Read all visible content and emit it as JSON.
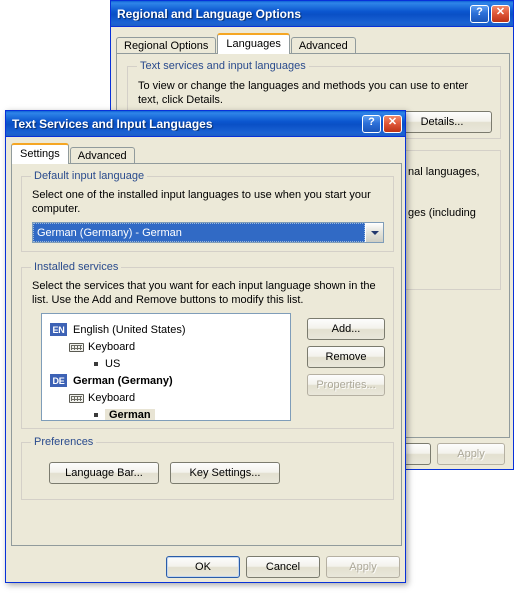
{
  "background_dialog": {
    "title": "Regional and Language Options",
    "titlebar_buttons": [
      {
        "name": "help-button",
        "glyph": "?"
      },
      {
        "name": "close-button",
        "glyph": "✕"
      }
    ],
    "tabs": [
      {
        "label": "Regional Options",
        "active": false
      },
      {
        "label": "Languages",
        "active": true
      },
      {
        "label": "Advanced",
        "active": false
      }
    ],
    "group_text_services": {
      "legend": "Text services and input languages",
      "description_line1": "To view or change the languages and methods you can use to enter",
      "description_line2": "text, click Details.",
      "details_button": "Details..."
    },
    "group_supplemental": {
      "clipped_line1": "nal languages,",
      "clipped_line2": "ges (including"
    },
    "apply_button": "Apply"
  },
  "foreground_dialog": {
    "title": "Text Services and Input Languages",
    "titlebar_buttons": [
      {
        "name": "help-button",
        "glyph": "?"
      },
      {
        "name": "close-button",
        "glyph": "✕"
      }
    ],
    "tabs": [
      {
        "label": "Settings",
        "active": true
      },
      {
        "label": "Advanced",
        "active": false
      }
    ],
    "default_input_language": {
      "legend": "Default input language",
      "description_line1": "Select one of the installed input languages to use when you start your",
      "description_line2": "computer.",
      "combo_value": "German (Germany) - German"
    },
    "installed_services": {
      "legend": "Installed services",
      "description_line1": "Select the services that you want for each input language shown in the",
      "description_line2": "list. Use the Add and Remove buttons to modify this list.",
      "tree": [
        {
          "level": 1,
          "badge": "EN",
          "label": "English (United States)",
          "bold": false,
          "selected": false,
          "icon": ""
        },
        {
          "level": 2,
          "badge": "",
          "label": "Keyboard",
          "bold": false,
          "selected": false,
          "icon": "keyboard-icon"
        },
        {
          "level": 3,
          "badge": "",
          "label": "US",
          "bold": false,
          "selected": false,
          "icon": "bullet-icon"
        },
        {
          "level": 1,
          "badge": "DE",
          "label": "German (Germany)",
          "bold": true,
          "selected": false,
          "icon": ""
        },
        {
          "level": 2,
          "badge": "",
          "label": "Keyboard",
          "bold": false,
          "selected": false,
          "icon": "keyboard-icon"
        },
        {
          "level": 3,
          "badge": "",
          "label": "German",
          "bold": true,
          "selected": true,
          "icon": "bullet-icon"
        }
      ],
      "buttons": [
        {
          "name": "add-button",
          "label": "Add...",
          "accel": "d",
          "disabled": false
        },
        {
          "name": "remove-button",
          "label": "Remove",
          "accel": "R",
          "disabled": false
        },
        {
          "name": "properties-button",
          "label": "Properties...",
          "accel": "P",
          "disabled": true
        }
      ]
    },
    "preferences": {
      "legend": "Preferences",
      "language_bar_button": "Language Bar...",
      "key_settings_button": "Key Settings..."
    },
    "footer_buttons": [
      {
        "name": "ok-button",
        "label": "OK",
        "default": true,
        "disabled": false
      },
      {
        "name": "cancel-button",
        "label": "Cancel",
        "default": false,
        "disabled": false
      },
      {
        "name": "apply-button",
        "label": "Apply",
        "default": false,
        "disabled": true
      }
    ]
  },
  "colors": {
    "titlebar_blue": "#0b56cf",
    "dialog_face": "#ece9d8",
    "selection_blue": "#316ac5",
    "badge_blue": "#3d62b5",
    "active_tab_accent": "#f5a623",
    "disabled_text": "#aca899",
    "group_legend_text": "#2a4b8d",
    "tree_selected_bg": "#e8e4d4"
  }
}
